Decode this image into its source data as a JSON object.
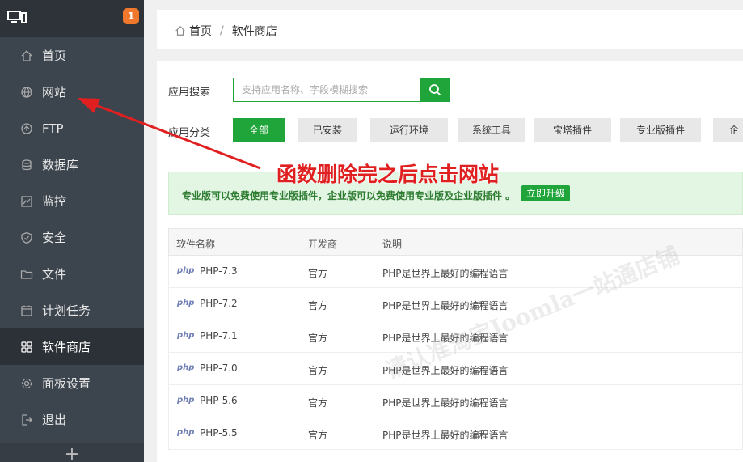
{
  "sidebar": {
    "badge": "1",
    "items": [
      {
        "label": "首页",
        "icon": "home-icon"
      },
      {
        "label": "网站",
        "icon": "globe-icon"
      },
      {
        "label": "FTP",
        "icon": "ftp-icon"
      },
      {
        "label": "数据库",
        "icon": "database-icon"
      },
      {
        "label": "监控",
        "icon": "monitor-chart-icon"
      },
      {
        "label": "安全",
        "icon": "shield-icon"
      },
      {
        "label": "文件",
        "icon": "folder-icon"
      },
      {
        "label": "计划任务",
        "icon": "calendar-icon"
      },
      {
        "label": "软件商店",
        "icon": "grid-icon"
      },
      {
        "label": "面板设置",
        "icon": "gear-icon"
      },
      {
        "label": "退出",
        "icon": "logout-icon"
      }
    ],
    "add": "+"
  },
  "breadcrumb": {
    "home": "首页",
    "sep": "/",
    "current": "软件商店"
  },
  "search": {
    "label": "应用搜索",
    "placeholder": "支持应用名称、字段模糊搜索"
  },
  "categories": {
    "label": "应用分类",
    "items": [
      "全部",
      "已安装",
      "运行环境",
      "系统工具",
      "宝塔插件",
      "专业版插件",
      "企业"
    ]
  },
  "promo": {
    "text": "专业版可以免费使用专业版插件，企业版可以免费使用专业版及企业版插件 。",
    "button": "立即升级"
  },
  "table": {
    "headers": [
      "软件名称",
      "开发商",
      "说明"
    ],
    "rows": [
      {
        "logo": "php",
        "name": "PHP-7.3",
        "dev": "官方",
        "desc": "PHP是世界上最好的编程语言"
      },
      {
        "logo": "php",
        "name": "PHP-7.2",
        "dev": "官方",
        "desc": "PHP是世界上最好的编程语言"
      },
      {
        "logo": "php",
        "name": "PHP-7.1",
        "dev": "官方",
        "desc": "PHP是世界上最好的编程语言"
      },
      {
        "logo": "php",
        "name": "PHP-7.0",
        "dev": "官方",
        "desc": "PHP是世界上最好的编程语言"
      },
      {
        "logo": "php",
        "name": "PHP-5.6",
        "dev": "官方",
        "desc": "PHP是世界上最好的编程语言"
      },
      {
        "logo": "php",
        "name": "PHP-5.5",
        "dev": "官方",
        "desc": "PHP是世界上最好的编程语言"
      }
    ]
  },
  "annotation": {
    "text": "函数删除完之后点击网站",
    "color": "#e02020"
  },
  "watermark": "请认准淘宝Joomla一站通店铺",
  "colors": {
    "accent": "#20a53a",
    "sidebar": "#3c444d",
    "badge": "#f0782d"
  }
}
